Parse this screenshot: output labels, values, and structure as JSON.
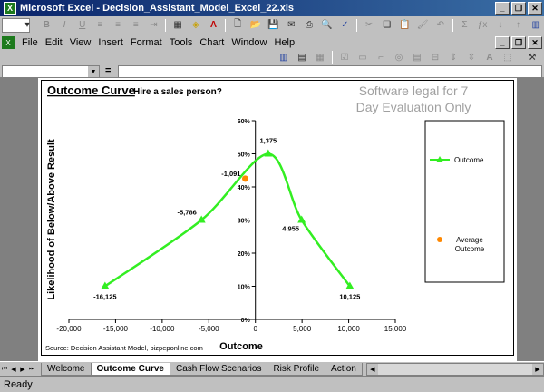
{
  "window": {
    "title": "Microsoft Excel - Decision_Assistant_Model_Excel_22.xls",
    "app_icon": "excel-icon"
  },
  "toolbar": {
    "bold_label": "B",
    "italic_label": "I",
    "underline_label": "U"
  },
  "menu": [
    "File",
    "Edit",
    "View",
    "Insert",
    "Format",
    "Tools",
    "Chart",
    "Window",
    "Help"
  ],
  "formula": {
    "eq": "=",
    "value": ""
  },
  "chart": {
    "title": "Outcome Curve",
    "subtitle": "Hire a sales person?",
    "watermark_line1": "Software legal for 7",
    "watermark_line2": "Day Evaluation Only",
    "source": "Source: Decision Assistant Model, bizpeponline.com",
    "legend_outcome": "Outcome",
    "legend_avg_line1": "Average",
    "legend_avg_line2": "Outcome"
  },
  "chart_data": {
    "type": "line",
    "title": "Outcome Curve",
    "subtitle": "Hire a sales person?",
    "xlabel": "Outcome",
    "ylabel": "Likelihood of Below/Above Result",
    "xlim": [
      -20000,
      15000
    ],
    "ylim": [
      0,
      0.6
    ],
    "x_ticks": [
      "-20,000",
      "-15,000",
      "-10,000",
      "-5,000",
      "0",
      "5,000",
      "10,000",
      "15,000"
    ],
    "x_tick_values": [
      -20000,
      -15000,
      -10000,
      -5000,
      0,
      5000,
      10000,
      15000
    ],
    "y_ticks": [
      "0%",
      "10%",
      "20%",
      "30%",
      "40%",
      "50%",
      "60%"
    ],
    "y_tick_values": [
      0,
      0.1,
      0.2,
      0.3,
      0.4,
      0.5,
      0.6
    ],
    "series": [
      {
        "name": "Outcome",
        "color": "#33ee22",
        "points": [
          {
            "x": -16125,
            "y": 0.1,
            "label": "-16,125"
          },
          {
            "x": -5786,
            "y": 0.3,
            "label": "-5,786"
          },
          {
            "x": 1375,
            "y": 0.5,
            "label": "1,375"
          },
          {
            "x": 4955,
            "y": 0.3,
            "label": "4,955"
          },
          {
            "x": 10125,
            "y": 0.1,
            "label": "10,125"
          }
        ]
      },
      {
        "name": "Average Outcome",
        "color": "#ff8800",
        "points": [
          {
            "x": -1091,
            "y": 0.425,
            "label": "-1,091"
          }
        ]
      }
    ],
    "legend": "right",
    "grid": false
  },
  "sheet_tabs": [
    "Welcome",
    "Outcome Curve",
    "Cash Flow Scenarios",
    "Risk Profile",
    "Action"
  ],
  "active_tab": "Outcome Curve",
  "status": "Ready"
}
